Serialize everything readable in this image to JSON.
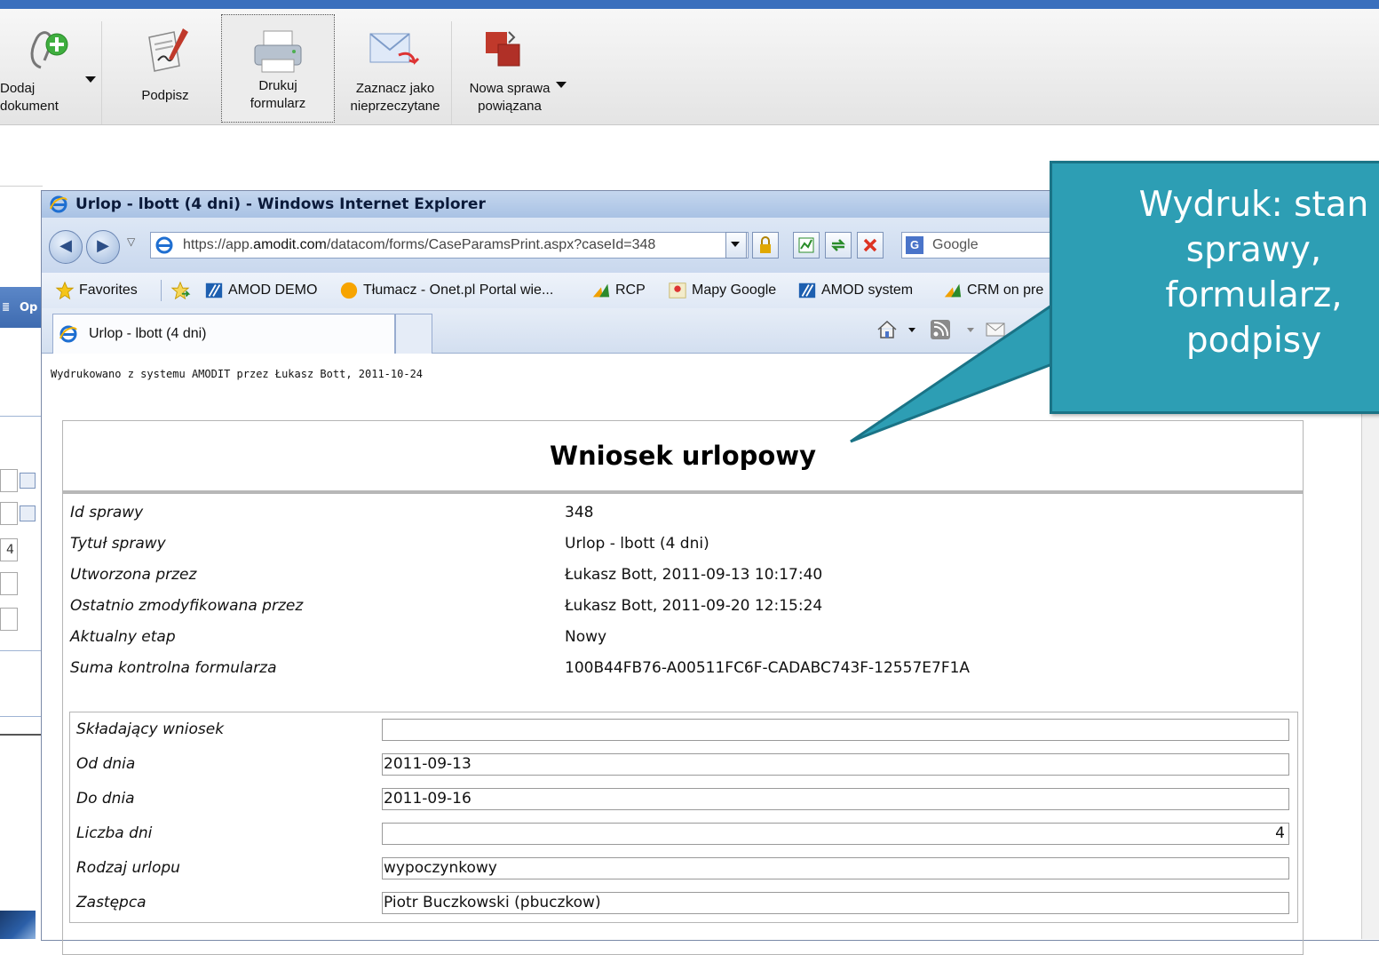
{
  "ribbon": {
    "add_document": "Dodaj\ndokument",
    "sign": "Podpisz",
    "print_form": "Drukuj\nformularz",
    "mark_unread": "Zaznacz jako\nnieprzeczytane",
    "new_related_case": "Nowa sprawa\npowiązana"
  },
  "background_app": {
    "left_button": "Op",
    "field_value": "4"
  },
  "browser": {
    "window_title": "Urlop - lbott (4 dni) - Windows Internet Explorer",
    "url_prefix": "https://app.",
    "url_domain": "amodit.com",
    "url_rest": "/datacom/forms/CaseParamsPrint.aspx?caseId=348",
    "search_placeholder": "Google",
    "favorites": {
      "label": "Favorites",
      "items": [
        "AMOD DEMO",
        "Tłumacz - Onet.pl Portal wie...",
        "RCP",
        "Mapy Google",
        "AMOD system",
        "CRM on pre"
      ]
    },
    "tab_title": "Urlop - lbott (4 dni)"
  },
  "print_page": {
    "printed_by": "Wydrukowano z systemu AMODIT przez Łukasz Bott, 2011-10-24",
    "form_title": "Wniosek urlopowy",
    "meta": [
      {
        "label": "Id sprawy",
        "value": "348"
      },
      {
        "label": "Tytuł sprawy",
        "value": "Urlop - lbott (4 dni)"
      },
      {
        "label": "Utworzona przez",
        "value": "Łukasz Bott, 2011-09-13 10:17:40"
      },
      {
        "label": "Ostatnio zmodyfikowana przez",
        "value": "Łukasz Bott, 2011-09-20 12:15:24"
      },
      {
        "label": "Aktualny etap",
        "value": "Nowy"
      },
      {
        "label": "Suma kontrolna formularza",
        "value": "100B44FB76-A00511FC6F-CADABC743F-12557E7F1A"
      }
    ],
    "fields": [
      {
        "label": "Składający wniosek",
        "value": ""
      },
      {
        "label": "Od dnia",
        "value": "2011-09-13"
      },
      {
        "label": "Do dnia",
        "value": "2011-09-16"
      },
      {
        "label": "Liczba dni",
        "value": "4"
      },
      {
        "label": "Rodzaj urlopu",
        "value": "wypoczynkowy"
      },
      {
        "label": "Zastępca",
        "value": "Piotr Buczkowski (pbuczkow)"
      }
    ]
  },
  "callout": {
    "lines": [
      "Wydruk: stan",
      "sprawy,",
      "formularz,",
      "podpisy"
    ]
  },
  "colors": {
    "callout_fill": "#2d9eb4",
    "ie_title_bar": "#a9c2e4",
    "ribbon_top": "#3a6fbd"
  }
}
